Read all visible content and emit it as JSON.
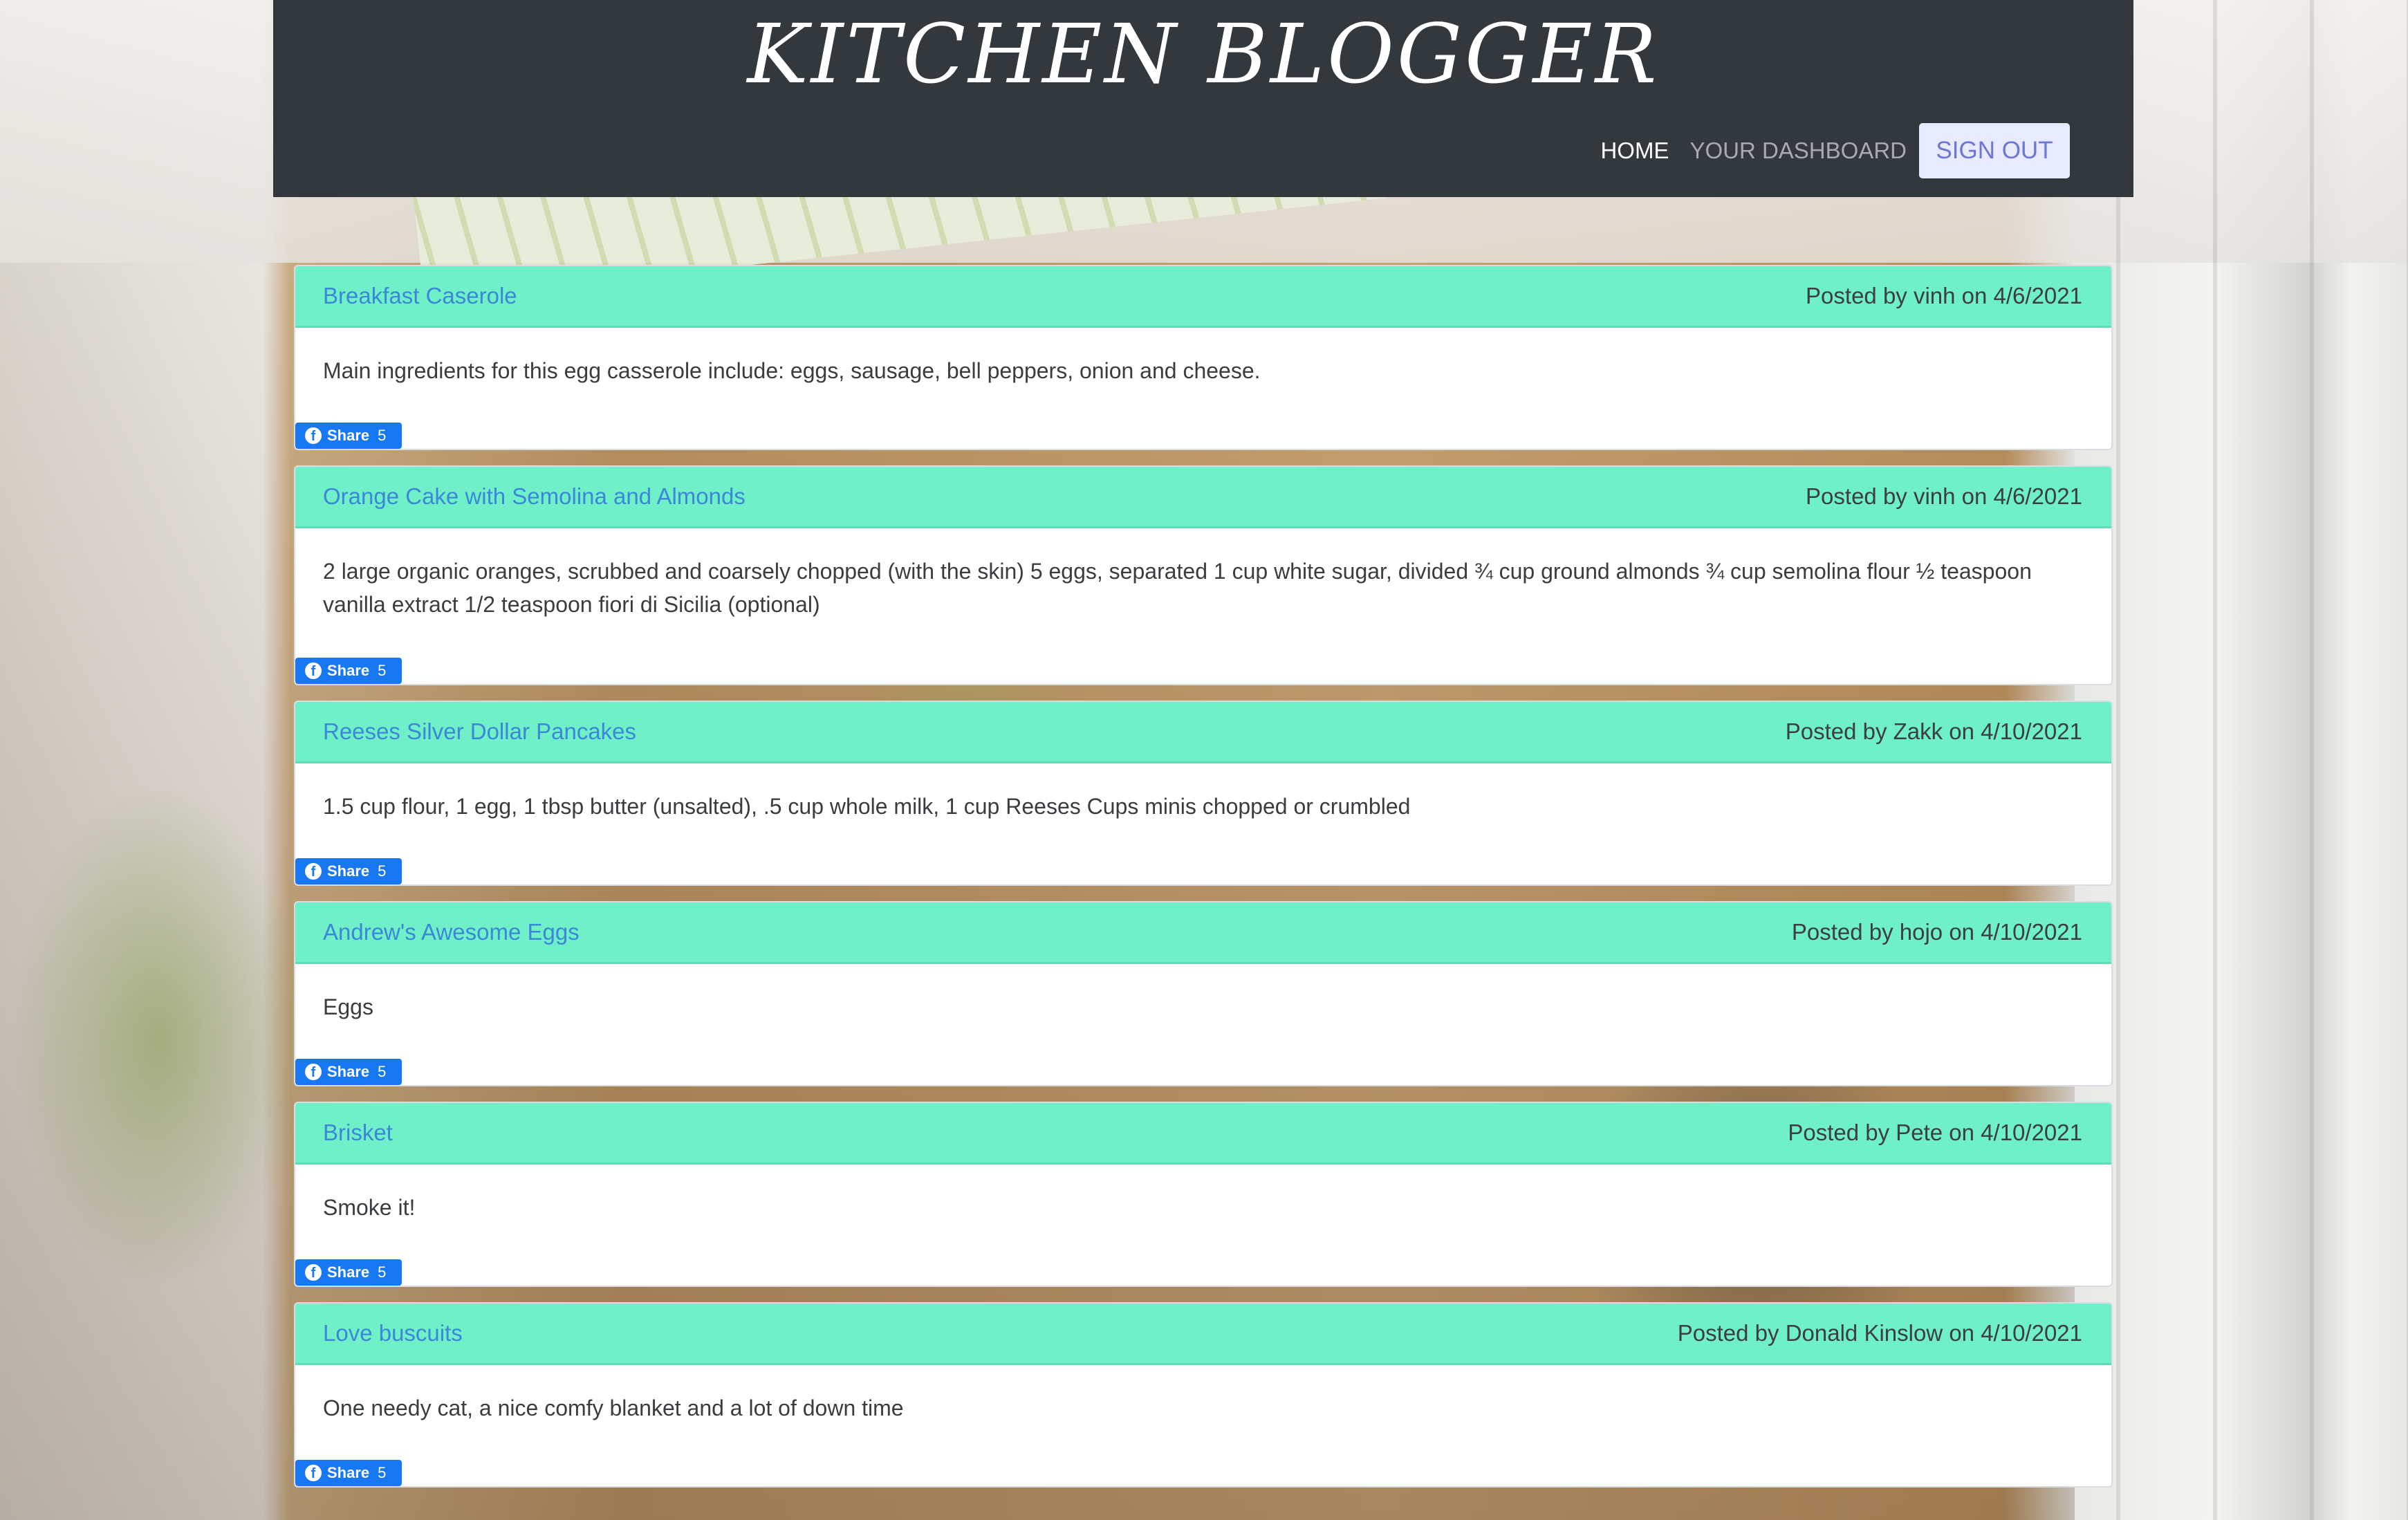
{
  "site": {
    "title": "KITCHEN BLOGGER"
  },
  "nav": {
    "home": "HOME",
    "dashboard": "YOUR DASHBOARD",
    "signout": "SIGN OUT"
  },
  "share": {
    "label": "Share",
    "count": "5",
    "icon": "facebook-icon"
  },
  "posts": [
    {
      "title": "Breakfast Caserole",
      "meta": "Posted by vinh on 4/6/2021",
      "body": "Main ingredients for this egg casserole include: eggs, sausage, bell peppers, onion and cheese."
    },
    {
      "title": "Orange Cake with Semolina and Almonds",
      "meta": "Posted by vinh on 4/6/2021",
      "body": "2 large organic oranges, scrubbed and coarsely chopped (with the skin) 5 eggs, separated 1 cup white sugar, divided ¾ cup ground almonds ¾ cup semolina flour ½ teaspoon vanilla extract 1/2 teaspoon fiori di Sicilia (optional)"
    },
    {
      "title": "Reeses Silver Dollar Pancakes",
      "meta": "Posted by Zakk on 4/10/2021",
      "body": "1.5 cup flour, 1 egg, 1 tbsp butter (unsalted), .5 cup whole milk, 1 cup Reeses Cups minis chopped or crumbled"
    },
    {
      "title": "Andrew's Awesome Eggs",
      "meta": "Posted by hojo on 4/10/2021",
      "body": "Eggs"
    },
    {
      "title": "Brisket",
      "meta": "Posted by Pete on 4/10/2021",
      "body": "Smoke it!"
    },
    {
      "title": "Love buscuits",
      "meta": "Posted by Donald Kinslow on 4/10/2021",
      "body": "One needy cat, a nice comfy blanket and a lot of down time"
    }
  ]
}
